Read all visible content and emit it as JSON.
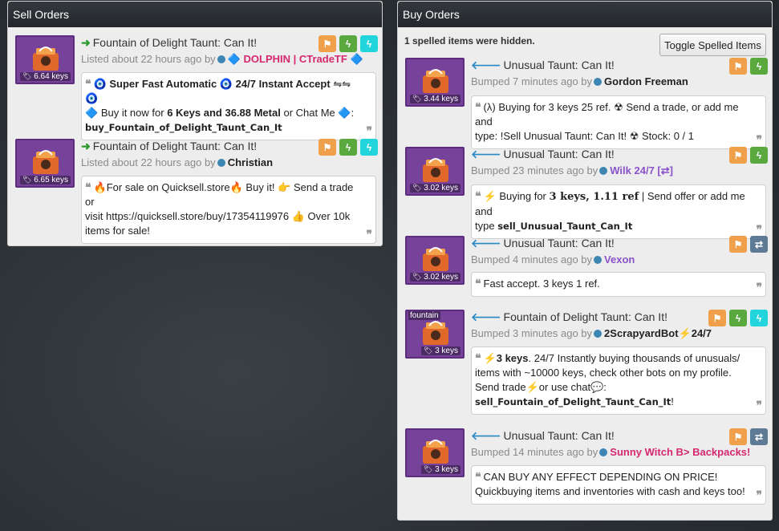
{
  "sell": {
    "title": "Sell Orders",
    "listings": [
      {
        "item": "Fountain of Delight Taunt: Can It!",
        "price": "6.64 keys",
        "listed": "Listed about 22 hours ago by",
        "user": "DOLPHIN | CTradeTF",
        "user_prefix": "🔷",
        "user_suffix": "🔷",
        "quote": {
          "p1_icon": "🧿",
          "p1_bold": "Super Fast Automatic",
          "p1_icon2": "🧿",
          "p1_bold2": "24/7 Instant Accept",
          "p1_arrows": "⇋⇋",
          "p1_icon3": "🧿",
          "p2_icon": "🔷",
          "p2_text": "Buy it now for",
          "p2_bold": "6 Keys and 36.88 Metal",
          "p2_text2": "or Chat Me",
          "p2_icon2": "🔷",
          "p2_end": ":",
          "cmd": "buy_Fountain_of_Delight_Taunt_Can_It"
        }
      },
      {
        "item": "Fountain of Delight Taunt: Can It!",
        "price": "6.65 keys",
        "listed": "Listed about 22 hours ago by",
        "user": "Christian",
        "quote": {
          "line1": "🔥For sale on Quicksell.store🔥 Buy it! 👉 Send a trade or",
          "line2": "visit https://quicksell.store/buy/17354119976 👍 Over 10k",
          "line3": "items for sale!"
        }
      }
    ]
  },
  "buy": {
    "title": "Buy Orders",
    "hidden_note": "1 spelled items were hidden.",
    "toggle_label": "Toggle Spelled Items",
    "listings": [
      {
        "item": "Unusual Taunt: Can It!",
        "price": "3.44 keys",
        "bumped": "Bumped 7 minutes ago by",
        "user": "Gordon Freeman",
        "quote": {
          "line1": "(λ) Buying for 3 keys 25 ref. ☢ Send a trade, or add me and",
          "line2": "type: !Sell Unusual Taunt: Can It! ☢ Stock: 0 / 1"
        }
      },
      {
        "item": "Unusual Taunt: Can It!",
        "price": "3.02 keys",
        "bumped": "Bumped 23 minutes ago by",
        "user": "Wilk 24/7 [⇄]",
        "quote": {
          "icon": "⚡",
          "t1": "Buying for",
          "b1": "3 keys, 1.11 ref",
          "t2": "| Send offer or add me and",
          "t3": "type",
          "cmd": "sell_Unusual_Taunt_Can_It"
        }
      },
      {
        "item": "Unusual Taunt: Can It!",
        "price": "3.02 keys",
        "bumped": "Bumped 4 minutes ago by",
        "user": "Vexon",
        "quote": {
          "line1": "Fast accept. 3 keys 1 ref."
        }
      },
      {
        "item": "Fountain of Delight Taunt: Can It!",
        "price": "3 keys",
        "effect": "fountain",
        "bumped": "Bumped 3 minutes ago by",
        "user": "2ScrapyardBot⚡24/7",
        "quote": {
          "icon": "⚡",
          "b1": "3 keys",
          "t1": ". 24/7 Instantly buying thousands of unusuals/",
          "line2": "items with ~10000 keys, check other bots on my profile.",
          "line3": "Send  trade⚡or  use  chat💬:",
          "cmd": "sell_Fountain_of_Delight_Taunt_Can_It",
          "cmd_end": "!"
        }
      },
      {
        "item": "Unusual Taunt: Can It!",
        "price": "3 keys",
        "bumped": "Bumped 14 minutes ago by",
        "user": "Sunny Witch B> Backpacks!",
        "quote": {
          "line1": "CAN BUY ANY EFFECT DEPENDING ON PRICE!",
          "line2": "Quickbuying items and inventories with cash and keys too!"
        }
      }
    ]
  },
  "icons": {
    "flag": "flag-icon",
    "lightning": "lightning-icon",
    "transfer": "transfer-icon",
    "tag": "price-tag-icon",
    "quote_open": "quote-open-icon",
    "quote_close": "quote-close-icon"
  },
  "colors": {
    "header": "#2a2f34",
    "panel": "#ededed",
    "btn_orange": "#f0a04a",
    "btn_green": "#5aa93e",
    "btn_cyan": "#22d5dc",
    "btn_slate": "#5e7a94",
    "item_border": "#76429a",
    "user_pink": "#d6286f",
    "user_purple": "#8a52c9"
  }
}
